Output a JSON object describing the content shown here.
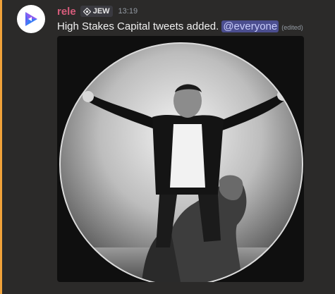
{
  "message": {
    "author": {
      "username": "rele",
      "role_tag": "JEW",
      "role_icon": "diamond-icon"
    },
    "timestamp": "13:19",
    "text": "High Stakes Capital tweets added.",
    "mention": "@everyone",
    "edited_label": "(edited)"
  },
  "colors": {
    "username": "#d65c7b",
    "mention_bg": "#4b4e8f",
    "mention_text": "#c9cdfb",
    "highlight_bar": "#f0a23a",
    "background": "#2b2a29"
  },
  "attachment": {
    "type": "image",
    "icon": "circular-photo"
  }
}
